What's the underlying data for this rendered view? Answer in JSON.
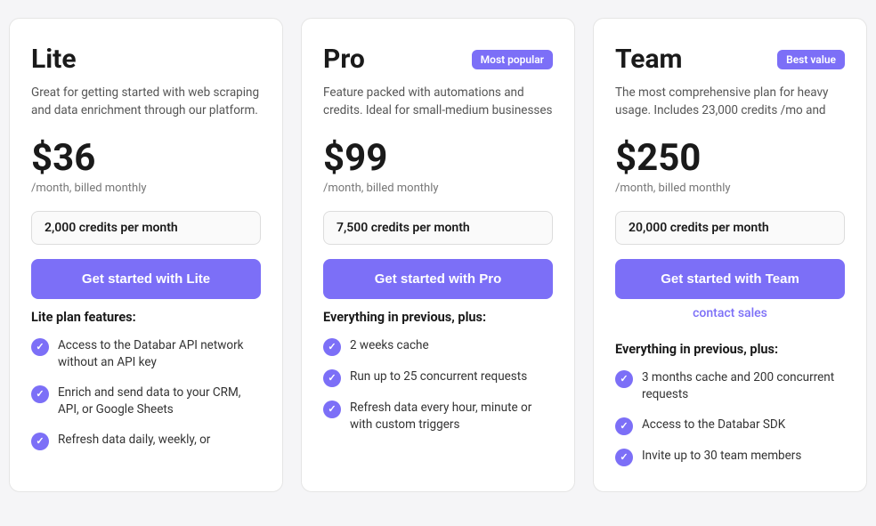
{
  "plans": [
    {
      "id": "lite",
      "name": "Lite",
      "badge": null,
      "description": "Great for getting started with web scraping and data enrichment through our platform.",
      "price": "$36",
      "billing": "/month, billed monthly",
      "credits": "2,000 credits per month",
      "cta_label": "Get started with Lite",
      "contact_sales": null,
      "features_title": "Lite plan features:",
      "features": [
        "Access to the Databar API network without an API key",
        "Enrich and send data to your CRM, API, or Google Sheets",
        "Refresh data daily, weekly, or"
      ]
    },
    {
      "id": "pro",
      "name": "Pro",
      "badge": "Most popular",
      "description": "Feature packed with automations and credits. Ideal for small-medium businesses",
      "price": "$99",
      "billing": "/month, billed monthly",
      "credits": "7,500 credits per month",
      "cta_label": "Get started with Pro",
      "contact_sales": null,
      "features_title": "Everything in previous, plus:",
      "features": [
        "2 weeks cache",
        "Run up to 25 concurrent requests",
        "Refresh data every hour, minute or with custom triggers"
      ]
    },
    {
      "id": "team",
      "name": "Team",
      "badge": "Best value",
      "description": "The most comprehensive plan for heavy usage. Includes 23,000 credits /mo and",
      "price": "$250",
      "billing": "/month, billed monthly",
      "credits": "20,000 credits per month",
      "cta_label": "Get started with Team",
      "contact_sales": "contact sales",
      "features_title": "Everything in previous, plus:",
      "features": [
        "3 months cache and 200 concurrent requests",
        "Access to the Databar SDK",
        "Invite up to 30 team members"
      ]
    }
  ]
}
